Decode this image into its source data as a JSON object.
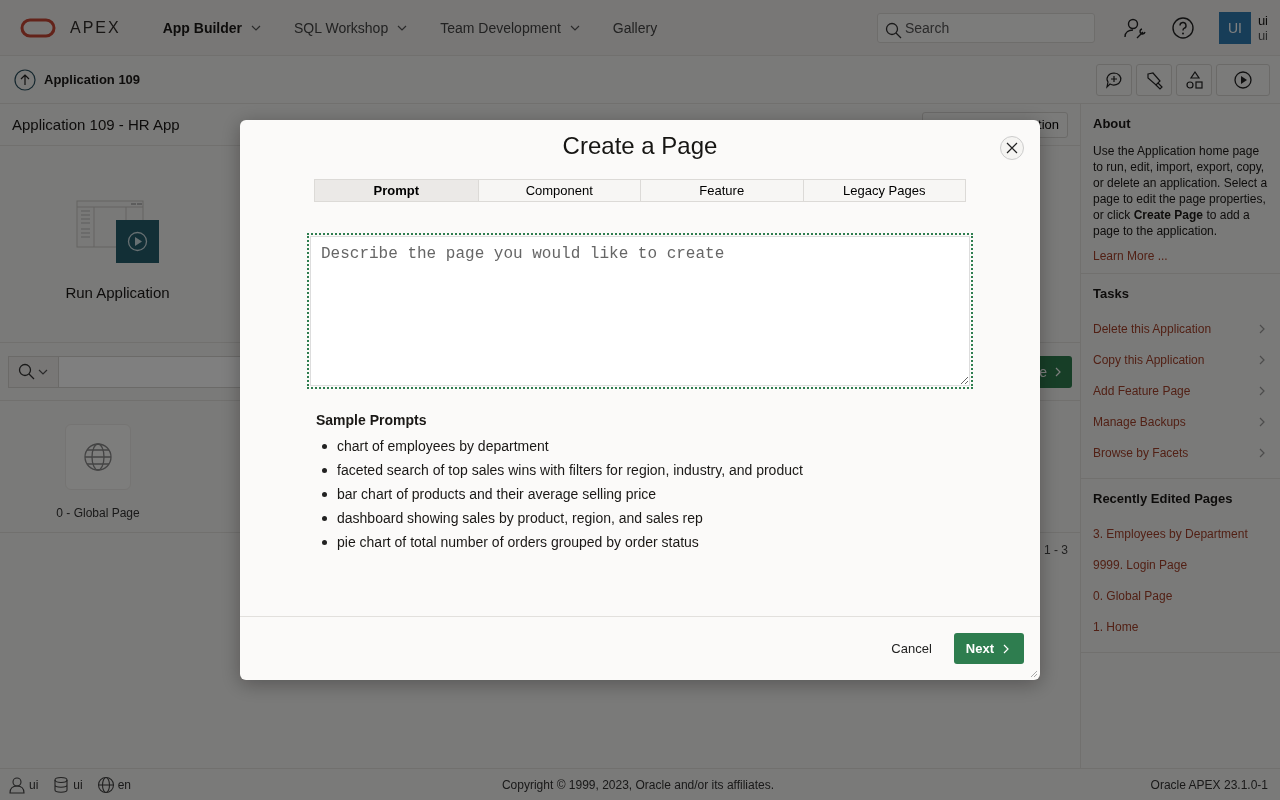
{
  "header": {
    "logo": "APEX",
    "nav": [
      {
        "label": "App Builder",
        "selected": true,
        "has_menu": true
      },
      {
        "label": "SQL Workshop",
        "selected": false,
        "has_menu": true
      },
      {
        "label": "Team Development",
        "selected": false,
        "has_menu": true
      },
      {
        "label": "Gallery",
        "selected": false,
        "has_menu": false
      }
    ],
    "search": {
      "placeholder": "Search"
    },
    "user": {
      "initials": "UI",
      "name": "ui",
      "workspace": "ui"
    }
  },
  "toolbar": {
    "breadcrumb": "Application 109"
  },
  "main": {
    "title": "Application 109 - HR App",
    "title_button": "tion",
    "cards": [
      {
        "label": "Run Application"
      }
    ],
    "search_button": "e",
    "pages": [
      {
        "label": "0 - Global Page"
      }
    ],
    "pagination": "1 - 3"
  },
  "sidebar": {
    "about": {
      "heading": "About",
      "text": "Use the Application home page to run, edit, import, export, copy, or delete an application. Select a page to edit the page properties, or click **Create Page** to add a page to the application.",
      "link": "Learn More ..."
    },
    "tasks": {
      "heading": "Tasks",
      "items": [
        "Delete this Application",
        "Copy this Application",
        "Add Feature Page",
        "Manage Backups",
        "Browse by Facets"
      ]
    },
    "recent": {
      "heading": "Recently Edited Pages",
      "items": [
        "3. Employees by Department",
        "9999. Login Page",
        "0. Global Page",
        "1. Home"
      ]
    }
  },
  "footer": {
    "user": "ui",
    "schema": "ui",
    "language": "en",
    "copyright": "Copyright © 1999, 2023, Oracle and/or its affiliates.",
    "version": "Oracle APEX 23.1.0-1"
  },
  "dialog": {
    "title": "Create a Page",
    "tabs": [
      {
        "label": "Prompt",
        "selected": true
      },
      {
        "label": "Component",
        "selected": false
      },
      {
        "label": "Feature",
        "selected": false
      },
      {
        "label": "Legacy Pages",
        "selected": false
      }
    ],
    "prompt": {
      "placeholder": "Describe the page you would like to create"
    },
    "samples_heading": "Sample Prompts",
    "samples": [
      "chart of employees by department",
      "faceted search of top sales wins with filters for region, industry, and product",
      "bar chart of products and their average selling price",
      "dashboard showing sales by product, region, and sales rep",
      "pie chart of total number of orders grouped by order status"
    ],
    "buttons": [
      {
        "label": "Cancel",
        "kind": "text"
      },
      {
        "label": "Next",
        "kind": "primary"
      }
    ]
  }
}
